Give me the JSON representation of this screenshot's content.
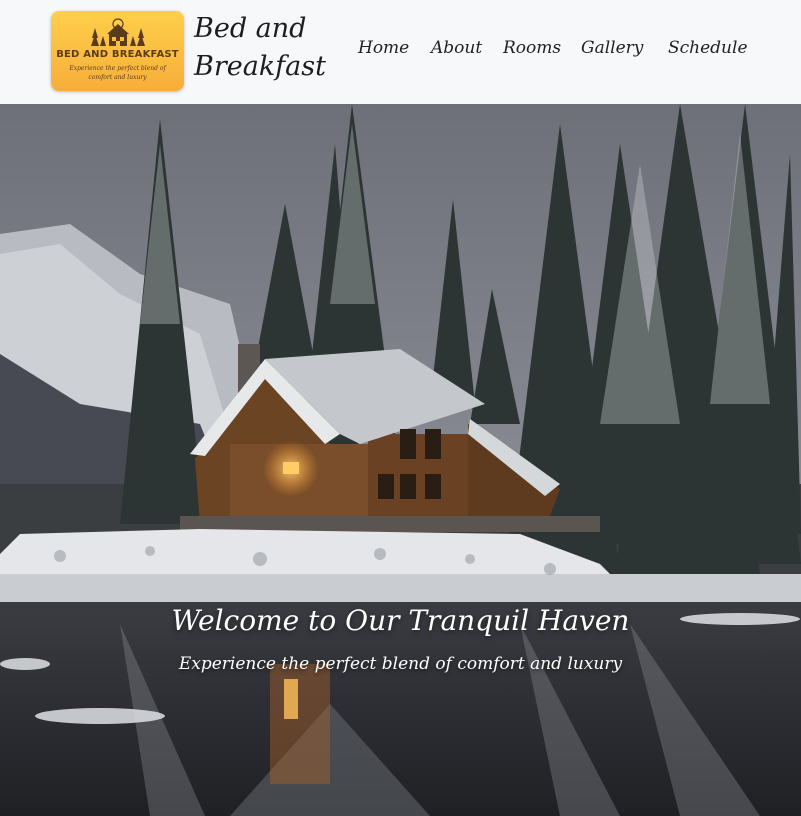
{
  "header": {
    "logo": {
      "title": "BED AND BREAKFAST",
      "tagline": "Experience the perfect blend of comfort and luxury",
      "background": "#f9bd3f"
    },
    "site_title": "Bed and Breakfast",
    "nav": {
      "items": [
        "Home",
        "About",
        "Rooms",
        "Gallery",
        "Schedule"
      ]
    }
  },
  "hero": {
    "image": "snowy-lakeside-cabin-photo",
    "heading": "Welcome to Our Tranquil Haven",
    "subheading": "Experience the perfect blend of comfort and luxury"
  }
}
